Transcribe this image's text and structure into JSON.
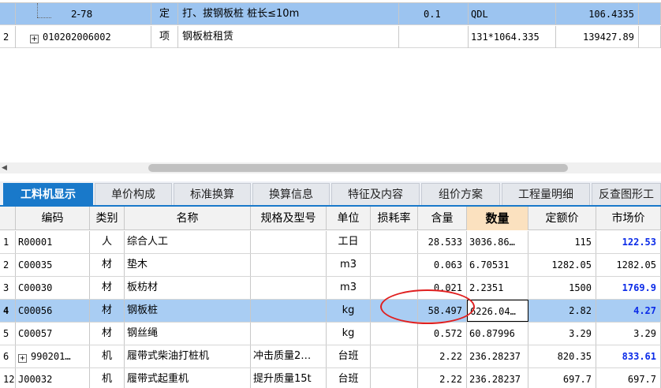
{
  "top_rows": [
    {
      "code": "2-78",
      "type": "定",
      "name": "打、拔钢板桩 桩长≤10m",
      "unit": "",
      "qty_expr": "0.1",
      "qty": "QDL",
      "price": "",
      "total": "106.4335"
    },
    {
      "row_num": "2",
      "expander": "+",
      "code": "010202006002",
      "type": "项",
      "name": "钢板桩租赁",
      "unit": "",
      "qty_expr": "",
      "qty": "131*1064.335",
      "price": "139427.89",
      "total": ""
    }
  ],
  "tabs": [
    {
      "label": "工料机显示",
      "active": true
    },
    {
      "label": "单价构成"
    },
    {
      "label": "标准换算"
    },
    {
      "label": "换算信息"
    },
    {
      "label": "特征及内容"
    },
    {
      "label": "组价方案"
    },
    {
      "label": "工程量明细"
    },
    {
      "label": "反查图形工"
    }
  ],
  "columns": {
    "code": "编码",
    "category": "类别",
    "name": "名称",
    "spec": "规格及型号",
    "unit": "单位",
    "loss": "损耗率",
    "content": "含量",
    "quantity": "数量",
    "quota_price": "定额价",
    "market_price": "市场价"
  },
  "rows": [
    {
      "num": "1",
      "code": "R00001",
      "category": "人",
      "name": "综合人工",
      "spec": "",
      "unit": "工日",
      "loss": "",
      "content": "28.533",
      "quantity": "3036.86…",
      "quota_price": "115",
      "market_price": "122.53",
      "market_changed": true
    },
    {
      "num": "2",
      "code": "C00035",
      "category": "材",
      "name": "垫木",
      "spec": "",
      "unit": "m3",
      "loss": "",
      "content": "0.063",
      "quantity": "6.70531",
      "quota_price": "1282.05",
      "market_price": "1282.05",
      "market_changed": false
    },
    {
      "num": "3",
      "code": "C00030",
      "category": "材",
      "name": "板枋材",
      "spec": "",
      "unit": "m3",
      "loss": "",
      "content": "0.021",
      "quantity": "2.2351",
      "quota_price": "1500",
      "market_price": "1769.9",
      "market_changed": true
    },
    {
      "num": "4",
      "code": "C00056",
      "category": "材",
      "name": "钢板桩",
      "spec": "",
      "unit": "kg",
      "loss": "",
      "content": "58.497",
      "quantity": "6226.04…",
      "quota_price": "2.82",
      "market_price": "4.27",
      "market_changed": true,
      "selected": true
    },
    {
      "num": "5",
      "code": "C00057",
      "category": "材",
      "name": "钢丝绳",
      "spec": "",
      "unit": "kg",
      "loss": "",
      "content": "0.572",
      "quantity": "60.87996",
      "quota_price": "3.29",
      "market_price": "3.29",
      "market_changed": false
    },
    {
      "num": "6",
      "expander": "+",
      "code": "990201…",
      "category": "机",
      "name": "履带式柴油打桩机",
      "spec": "冲击质量2…",
      "unit": "台班",
      "loss": "",
      "content": "2.22",
      "quantity": "236.28237",
      "quota_price": "820.35",
      "market_price": "833.61",
      "market_changed": true
    },
    {
      "num": "12",
      "code": "J00032",
      "category": "机",
      "name": "履带式起重机",
      "spec": "提升质量15t",
      "unit": "台班",
      "loss": "",
      "content": "2.22",
      "quantity": "236.28237",
      "quota_price": "697.7",
      "market_price": "697.7",
      "market_changed": false
    }
  ],
  "colors": {
    "tab_active": "#1979ca",
    "selected_row": "#a9cdf3",
    "top_selected_row": "#9cc4f0",
    "changed_price": "#0b2be8",
    "annotation": "#e02020"
  }
}
